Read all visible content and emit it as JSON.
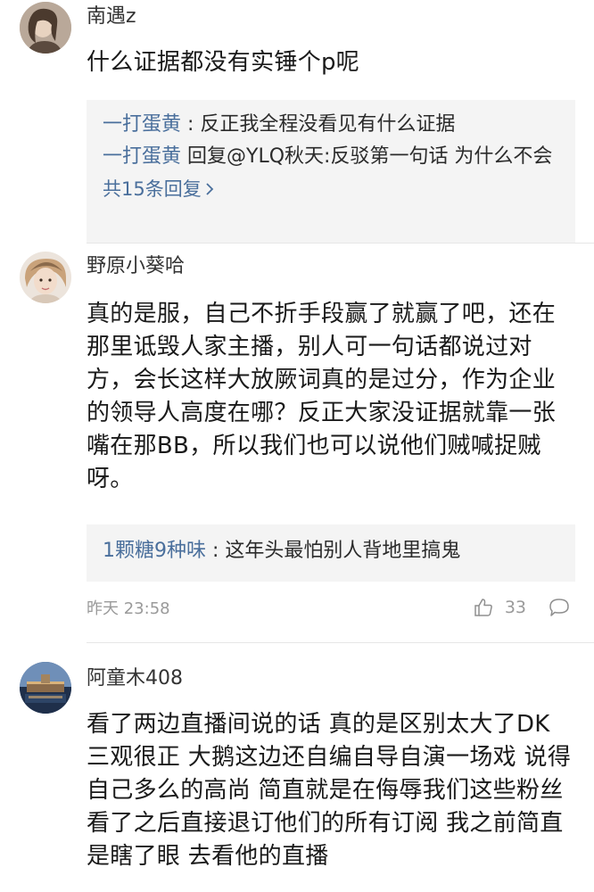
{
  "comments": [
    {
      "username": "南遇z",
      "text": "什么证据都没有实锤个p呢",
      "replies": [
        {
          "name": "一打蛋黄",
          "sep": " : ",
          "text": "反正我全程没看见有什么证据"
        },
        {
          "name": "一打蛋黄",
          "sep": " ",
          "text": "回复@YLQ秋天:反驳第一句话 为什么不会"
        }
      ],
      "more_replies": "共15条回复"
    },
    {
      "username": "野原小葵哈",
      "text": "真的是服，自己不折手段赢了就赢了吧，还在那里诋毁人家主播，别人可一句话都说过对方，会长这样大放厥词真的是过分，作为企业的领导人高度在哪？反正大家没证据就靠一张嘴在那BB，所以我们也可以说他们贼喊捉贼呀。",
      "replies": [
        {
          "name": "1颗糖9种味",
          "sep": " : ",
          "text": "这年头最怕别人背地里搞鬼"
        }
      ],
      "timestamp": "昨天 23:58",
      "likes": "33"
    },
    {
      "username": "阿童木408",
      "text": "看了两边直播间说的话 真的是区别太大了DK三观很正 大鹅这边还自编自导自演一场戏 说得自己多么的高尚 简直就是在侮辱我们这些粉丝 看了之后直接退订他们的所有订阅 我之前简直是瞎了眼 去看他的直播"
    }
  ],
  "icons": {
    "like": "thumbs-up-icon",
    "comment": "comment-bubble-icon",
    "chevron": "chevron-right-icon"
  },
  "colors": {
    "link": "#4a6f9c",
    "reply_bg": "#f4f4f4",
    "meta": "#9a9a9a"
  }
}
